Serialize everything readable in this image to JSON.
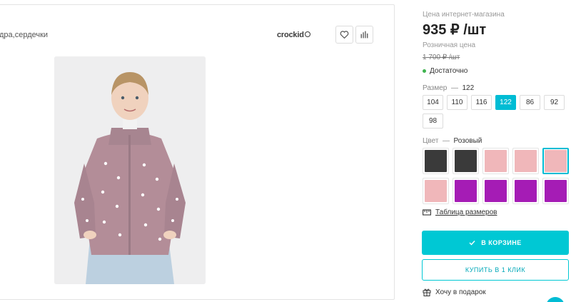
{
  "product": {
    "title_fragment": "дра,сердечки",
    "brand": "crockid",
    "image_alt": ""
  },
  "price": {
    "online_label": "Цена интернет-магазина",
    "online_value": "935 ₽ /шт",
    "retail_label": "Розничная цена",
    "retail_value": "1 700 ₽ /шт",
    "stock_text": "Достаточно"
  },
  "size": {
    "label": "Размер",
    "dash": "—",
    "selected": "122",
    "options": [
      "104",
      "110",
      "116",
      "122",
      "86",
      "92",
      "98"
    ]
  },
  "color": {
    "label": "Цвет",
    "dash": "—",
    "selected": "Розовый",
    "swatches": [
      "#3a3a3a",
      "#3a3a3a",
      "#f0b7ba",
      "#f0b7ba",
      "#f0b7ba",
      "#f0b7ba",
      "#a51cb5",
      "#a51cb5",
      "#a51cb5",
      "#a51cb5"
    ]
  },
  "links": {
    "size_table": "Таблица размеров",
    "gift": "Хочу в подарок"
  },
  "buttons": {
    "cart": "В КОРЗИНЕ",
    "one_click": "КУПИТЬ В 1 КЛИК"
  },
  "colors": {
    "accent": "#00c8d4",
    "in_stock": "#3fb34f"
  }
}
